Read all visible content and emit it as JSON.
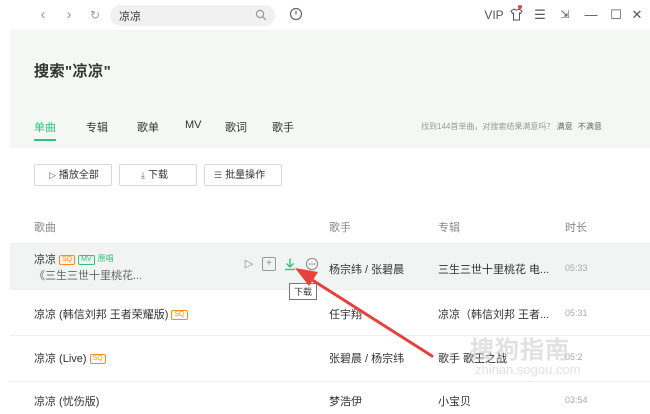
{
  "search": {
    "query": "凉凉"
  },
  "window": {
    "vip": "VIP"
  },
  "page": {
    "title": "搜索\"凉凉\""
  },
  "tabs": [
    "单曲",
    "专辑",
    "歌单",
    "MV",
    "歌词",
    "歌手"
  ],
  "result_info": {
    "text": "找到144首单曲，对搜索结果满意吗？",
    "yes": "满意",
    "no": "不满意"
  },
  "toolbar": {
    "play_all": "播放全部",
    "download": "下载",
    "batch": "批量操作"
  },
  "columns": {
    "song": "歌曲",
    "singer": "歌手",
    "album": "专辑",
    "duration": "时长"
  },
  "tags": {
    "sq": "SQ",
    "mv": "MV",
    "origin": "原唱"
  },
  "rows": [
    {
      "title": "凉凉",
      "subtitle": "《三生三世十里桃花...",
      "singer": "杨宗纬 / 张碧晨",
      "album": "三生三世十里桃花 电...",
      "duration": "05:33"
    },
    {
      "title": "凉凉 (韩信刘邦 王者荣耀版)",
      "singer": "任宇翔",
      "album": "凉凉（韩信刘邦 王者...",
      "duration": "05:31"
    },
    {
      "title": "凉凉 (Live)",
      "singer": "张碧晨 / 杨宗纬",
      "album": "歌手 歌王之战",
      "duration": "05:2"
    },
    {
      "title": "凉凉 (忧伤版)",
      "singer": "梦浩伊",
      "album": "小宝贝",
      "duration": "03:54"
    }
  ],
  "tooltip": {
    "download": "下载"
  },
  "watermark": {
    "main": "搜狗指南",
    "sub": "zhinan.sogou.com"
  },
  "colors": {
    "accent": "#31c27c",
    "sq": "#ff8c1a",
    "arrow": "#e8403a"
  }
}
